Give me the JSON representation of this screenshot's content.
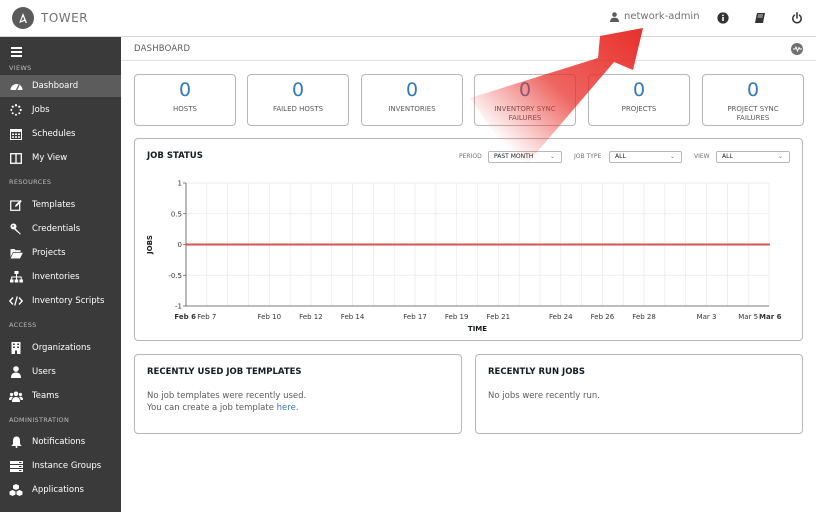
{
  "header": {
    "app_name": "TOWER",
    "user": "network-admin"
  },
  "sidebar": {
    "sections": {
      "views": "VIEWS",
      "resources": "RESOURCES",
      "access": "ACCESS",
      "administration": "ADMINISTRATION"
    },
    "items": [
      {
        "label": "Dashboard",
        "icon": "tachometer-icon"
      },
      {
        "label": "Jobs",
        "icon": "spinner-icon"
      },
      {
        "label": "Schedules",
        "icon": "calendar-icon"
      },
      {
        "label": "My View",
        "icon": "columns-icon"
      },
      {
        "label": "Templates",
        "icon": "edit-icon"
      },
      {
        "label": "Credentials",
        "icon": "key-icon"
      },
      {
        "label": "Projects",
        "icon": "folder-open-icon"
      },
      {
        "label": "Inventories",
        "icon": "sitemap-icon"
      },
      {
        "label": "Inventory Scripts",
        "icon": "code-icon"
      },
      {
        "label": "Organizations",
        "icon": "building-icon"
      },
      {
        "label": "Users",
        "icon": "user-icon"
      },
      {
        "label": "Teams",
        "icon": "users-icon"
      },
      {
        "label": "Notifications",
        "icon": "bell-icon"
      },
      {
        "label": "Instance Groups",
        "icon": "server-icon"
      },
      {
        "label": "Applications",
        "icon": "cubes-icon"
      }
    ]
  },
  "breadcrumb": "DASHBOARD",
  "counts": [
    {
      "value": "0",
      "label": "HOSTS"
    },
    {
      "value": "0",
      "label": "FAILED HOSTS"
    },
    {
      "value": "0",
      "label": "INVENTORIES"
    },
    {
      "value": "0",
      "label": "INVENTORY SYNC FAILURES"
    },
    {
      "value": "0",
      "label": "PROJECTS"
    },
    {
      "value": "0",
      "label": "PROJECT SYNC FAILURES"
    }
  ],
  "job_status": {
    "title": "JOB STATUS",
    "period_label": "PERIOD",
    "period_value": "PAST MONTH",
    "job_type_label": "JOB TYPE",
    "job_type_value": "ALL",
    "view_label": "VIEW",
    "view_value": "ALL"
  },
  "chart_data": {
    "type": "line",
    "xlabel": "TIME",
    "ylabel": "JOBS",
    "ylim": [
      -1,
      1
    ],
    "yticks": [
      "1",
      "0.5",
      "0",
      "-0.5",
      "-1"
    ],
    "xtick_labels": [
      "Feb 6",
      "Feb 7",
      "Feb 10",
      "Feb 12",
      "Feb 14",
      "Feb 17",
      "Feb 19",
      "Feb 21",
      "Feb 24",
      "Feb 26",
      "Feb 28",
      "Mar 3",
      "Mar 5",
      "Mar 6"
    ],
    "x": [
      "Feb 6",
      "Feb 7",
      "Feb 8",
      "Feb 9",
      "Feb 10",
      "Feb 11",
      "Feb 12",
      "Feb 13",
      "Feb 14",
      "Feb 15",
      "Feb 16",
      "Feb 17",
      "Feb 18",
      "Feb 19",
      "Feb 20",
      "Feb 21",
      "Feb 22",
      "Feb 23",
      "Feb 24",
      "Feb 25",
      "Feb 26",
      "Feb 27",
      "Feb 28",
      "Mar 1",
      "Mar 2",
      "Mar 3",
      "Mar 4",
      "Mar 5",
      "Mar 6"
    ],
    "series": [
      {
        "values": [
          0,
          0,
          0,
          0,
          0,
          0,
          0,
          0,
          0,
          0,
          0,
          0,
          0,
          0,
          0,
          0,
          0,
          0,
          0,
          0,
          0,
          0,
          0,
          0,
          0,
          0,
          0,
          0,
          0
        ],
        "color": "#d9534f"
      },
      {
        "values": [
          0,
          0,
          0,
          0,
          0,
          0,
          0,
          0,
          0,
          0,
          0,
          0,
          0,
          0,
          0,
          0,
          0,
          0,
          0,
          0,
          0,
          0,
          0,
          0,
          0,
          0,
          0,
          0,
          0
        ],
        "color": "#5cb85c"
      }
    ],
    "grid": true
  },
  "recent_templates": {
    "title": "RECENTLY USED JOB TEMPLATES",
    "line1": "No job templates were recently used.",
    "line2_prefix": "You can create a job template ",
    "link": "here",
    "line2_suffix": "."
  },
  "recent_jobs": {
    "title": "RECENTLY RUN JOBS",
    "text": "No jobs were recently run."
  },
  "colors": {
    "sidebar": "#3a3a3a",
    "accent": "#337ab7",
    "arrow": "#e8312c"
  }
}
